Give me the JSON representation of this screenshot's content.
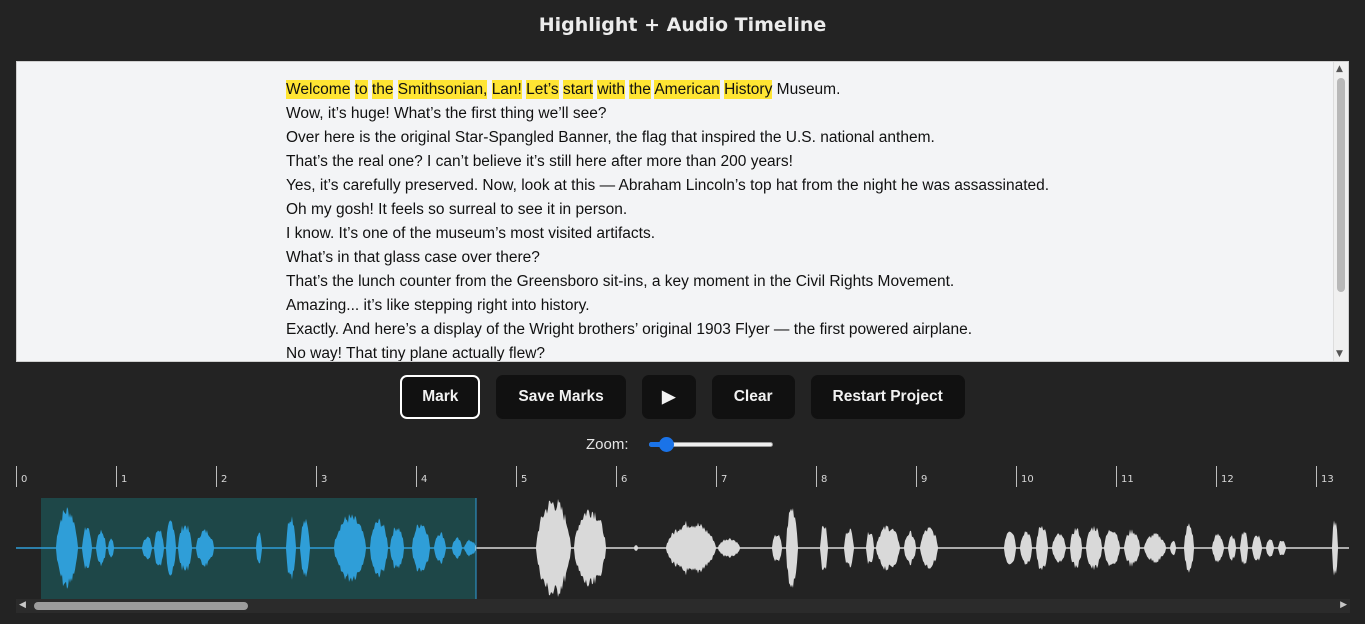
{
  "app": {
    "title": "Highlight + Audio Timeline"
  },
  "transcript": {
    "lines": [
      "Welcome to the Smithsonian, Lan! Let’s start with the American History Museum.",
      "Wow, it’s huge! What’s the first thing we’ll see?",
      "Over here is the original Star-Spangled Banner, the flag that inspired the U.S. national anthem.",
      "That’s the real one? I can’t believe it’s still here after more than 200 years!",
      "Yes, it’s carefully preserved. Now, look at this — Abraham Lincoln’s top hat from the night he was assassinated.",
      "Oh my gosh! It feels so surreal to see it in person.",
      "I know. It’s one of the museum’s most visited artifacts.",
      "What’s in that glass case over there?",
      "That’s the lunch counter from the Greensboro sit-ins, a key moment in the Civil Rights Movement.",
      "Amazing... it’s like stepping right into history.",
      "Exactly. And here’s a display of the Wright brothers’ original 1903 Flyer — the first powered airplane.",
      "No way! That tiny plane actually flew?"
    ],
    "highlighted_word_count": 11,
    "highlight_color": "#ffe533"
  },
  "controls": {
    "mark": "Mark",
    "save_marks": "Save Marks",
    "play_icon": "▶",
    "clear": "Clear",
    "restart": "Restart Project"
  },
  "zoom": {
    "label": "Zoom:",
    "value": 0.1
  },
  "timeline": {
    "ticks": [
      "0",
      "1",
      "2",
      "3",
      "4",
      "5",
      "6",
      "7",
      "8",
      "9",
      "10",
      "11",
      "12",
      "13"
    ],
    "selection_start_sec": 0.25,
    "selection_end_sec": 4.6,
    "played_color": "#2f9ed8",
    "unplayed_color": "#d9d9d9",
    "selection_color": "#1e4748"
  }
}
